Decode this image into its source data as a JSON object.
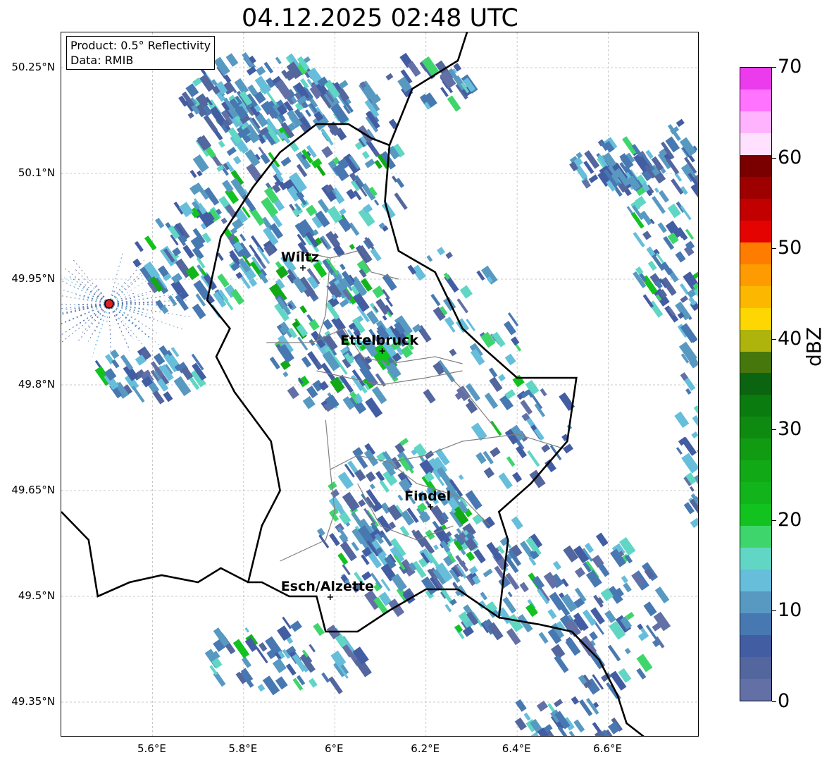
{
  "title": "04.12.2025 02:48 UTC",
  "info": {
    "product": "Product: 0.5° Reflectivity",
    "data": "Data: RMIB"
  },
  "map": {
    "lon_range": [
      5.4,
      6.8
    ],
    "lat_range": [
      49.3,
      50.3
    ],
    "lat_ticks": [
      {
        "value": 50.25,
        "label": "50.25°N"
      },
      {
        "value": 50.1,
        "label": "50.1°N"
      },
      {
        "value": 49.95,
        "label": "49.95°N"
      },
      {
        "value": 49.8,
        "label": "49.8°N"
      },
      {
        "value": 49.65,
        "label": "49.65°N"
      },
      {
        "value": 49.5,
        "label": "49.5°N"
      },
      {
        "value": 49.35,
        "label": "49.35°N"
      }
    ],
    "lon_ticks": [
      {
        "value": 5.6,
        "label": "5.6°E"
      },
      {
        "value": 5.8,
        "label": "5.8°E"
      },
      {
        "value": 6.0,
        "label": "6°E"
      },
      {
        "value": 6.2,
        "label": "6.2°E"
      },
      {
        "value": 6.4,
        "label": "6.4°E"
      },
      {
        "value": 6.6,
        "label": "6.6°E"
      }
    ],
    "cities": [
      {
        "name": "Wiltz",
        "lon": 5.93,
        "lat": 49.966
      },
      {
        "name": "Ettelbruck",
        "lon": 6.104,
        "lat": 49.848
      },
      {
        "name": "Findel",
        "lon": 6.21,
        "lat": 49.627
      },
      {
        "name": "Esch/Alzette",
        "lon": 5.99,
        "lat": 49.499
      }
    ],
    "radar_site": {
      "lon": 5.505,
      "lat": 49.915
    },
    "colors": {
      "border": "#000000",
      "canton": "#808080",
      "grid": "#bbbbbb",
      "radar_site": "#e02020"
    }
  },
  "colorbar": {
    "label": "dBZ",
    "min": 0,
    "max": 70,
    "ticks": [
      "0",
      "10",
      "20",
      "30",
      "40",
      "50",
      "60",
      "70"
    ],
    "colors": [
      "#6370a6",
      "#53669e",
      "#435da3",
      "#4878b1",
      "#5899c2",
      "#66bedb",
      "#61d6c5",
      "#3ed66c",
      "#12c31f",
      "#11b51b",
      "#11a916",
      "#109b13",
      "#0e8a10",
      "#0a7b0e",
      "#0b6410",
      "#46770d",
      "#afb40c",
      "#fed601",
      "#fcb800",
      "#fe9b01",
      "#fe7d00",
      "#e40300",
      "#c20000",
      "#9e0000",
      "#7a0000",
      "#ffe0ff",
      "#ffb3ff",
      "#ff73ff",
      "#ec3bec"
    ]
  }
}
